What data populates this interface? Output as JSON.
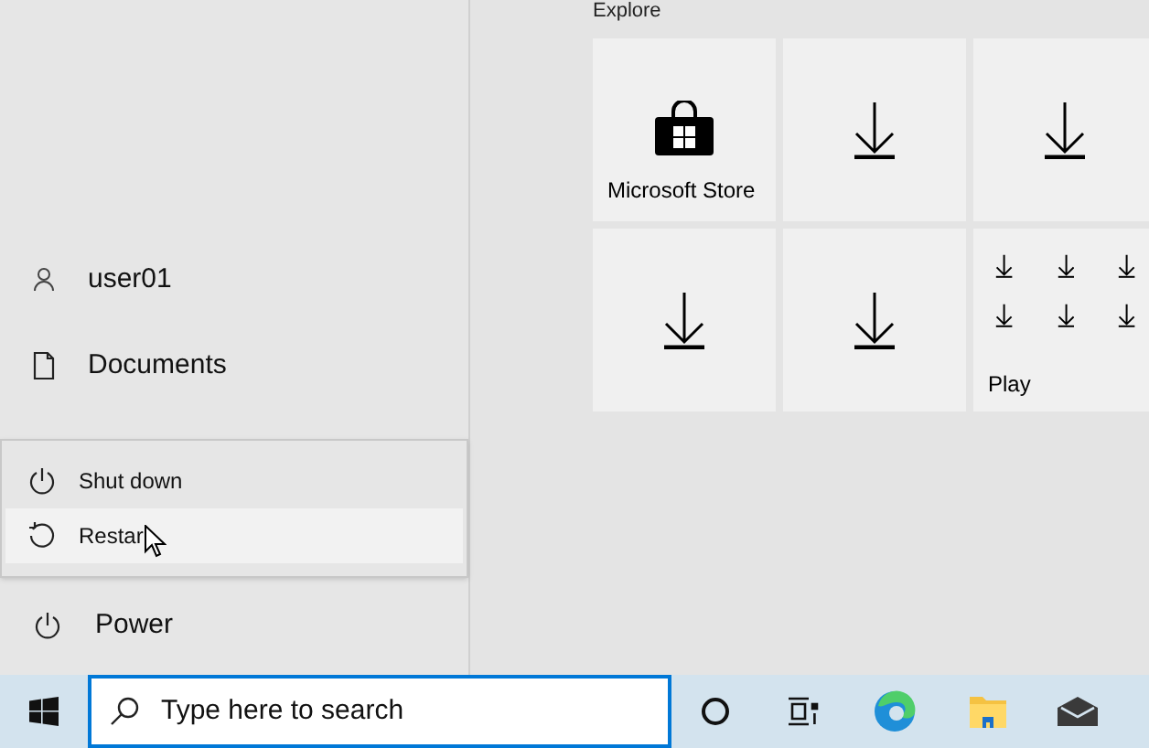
{
  "start_menu": {
    "user": "user01",
    "items": [
      {
        "label": "Documents"
      }
    ],
    "power_menu": [
      {
        "label": "Shut down",
        "kind": "shutdown",
        "selected": false
      },
      {
        "label": "Restar",
        "kind": "restart",
        "selected": true
      }
    ],
    "power": "Power"
  },
  "tiles_section": {
    "title": "Explore",
    "tiles": [
      {
        "kind": "app",
        "label": "Microsoft Store"
      },
      {
        "kind": "pending"
      },
      {
        "kind": "pending"
      },
      {
        "kind": "pending"
      },
      {
        "kind": "pending"
      },
      {
        "kind": "folder",
        "label": "Play",
        "items": [
          {
            "kind": "pending"
          },
          {
            "kind": "pending"
          },
          {
            "kind": "pending"
          },
          {
            "kind": "pending"
          },
          {
            "kind": "pending"
          },
          {
            "kind": "pending"
          }
        ]
      }
    ]
  },
  "taskbar": {
    "search_placeholder": "Type here to search"
  }
}
